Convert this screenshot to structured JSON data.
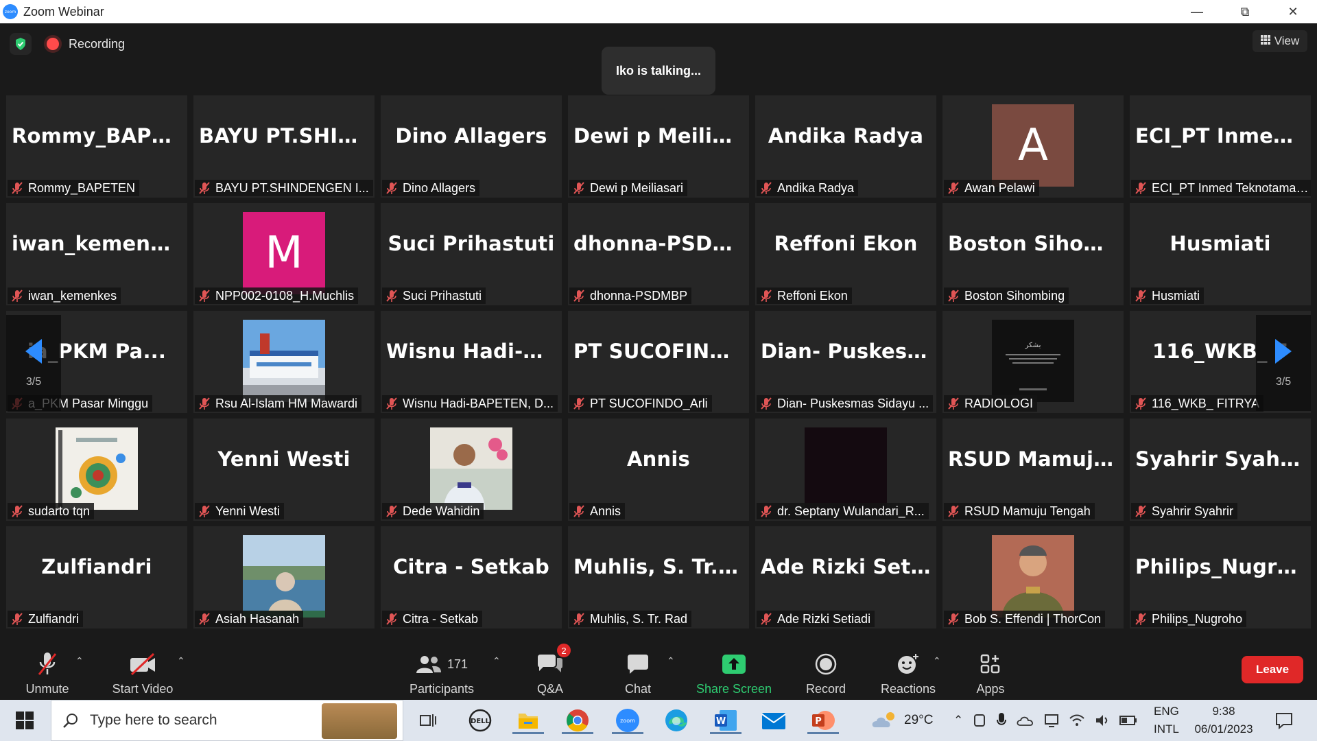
{
  "window": {
    "title": "Zoom Webinar"
  },
  "topbar": {
    "recording": "Recording",
    "talking": "Iko is talking...",
    "view": "View"
  },
  "tiles": [
    {
      "big": "Rommy_BAPET...",
      "label": "Rommy_BAPETEN"
    },
    {
      "big": "BAYU  PT.SHIND...",
      "label": "BAYU PT.SHINDENGEN I..."
    },
    {
      "big": "Dino Allagers",
      "label": "Dino Allagers"
    },
    {
      "big": "Dewi p Meiliasari",
      "label": "Dewi p Meiliasari"
    },
    {
      "big": "Andika Radya",
      "label": "Andika Radya"
    },
    {
      "avatar": "A",
      "avatar_color": "#7a4a40",
      "label": "Awan Pelawi"
    },
    {
      "big": "ECI_PT  Inmed  T...",
      "label": "ECI_PT Inmed Teknotama ..."
    },
    {
      "big": "iwan_kemenkes",
      "label": "iwan_kemenkes"
    },
    {
      "avatar": "M",
      "avatar_color": "#d81b7a",
      "label": "NPP002-0108_H.Muchlis"
    },
    {
      "big": "Suci Prihastuti",
      "label": "Suci Prihastuti"
    },
    {
      "big": "dhonna-PSDMBP",
      "label": "dhonna-PSDMBP"
    },
    {
      "big": "Reffoni Ekon",
      "label": "Reffoni Ekon"
    },
    {
      "big": "Boston  Sihombi...",
      "label": "Boston Sihombing"
    },
    {
      "big": "Husmiati",
      "label": "Husmiati"
    },
    {
      "big": "ia_PKM  Pa...",
      "label": "a_PKM Pasar Minggu"
    },
    {
      "pic": "hospital",
      "label": "Rsu Al-Islam HM Mawardi"
    },
    {
      "big": "Wisnu  Hadi-BA...",
      "label": "Wisnu Hadi-BAPETEN, D..."
    },
    {
      "big": "PT  SUCOFINDO...",
      "label": "PT SUCOFINDO_Arli"
    },
    {
      "big": "Dian-  Puskesma...",
      "label": "Dian- Puskesmas Sidayu ..."
    },
    {
      "pic": "dark-doc",
      "label": "RADIOLOGI"
    },
    {
      "big": "116_WKB_  F",
      "label": "116_WKB_ FITRYA"
    },
    {
      "pic": "book",
      "label": "sudarto tqn"
    },
    {
      "big": "Yenni Westi",
      "label": "Yenni Westi"
    },
    {
      "pic": "person-flowers",
      "label": "Dede Wahidin"
    },
    {
      "big": "Annis",
      "label": "Annis"
    },
    {
      "pic": "black",
      "label": "dr. Septany Wulandari_R..."
    },
    {
      "big": "RSUD  Mamuju...",
      "label": "RSUD Mamuju Tengah"
    },
    {
      "big": "Syahrir Syahrir",
      "label": "Syahrir Syahrir"
    },
    {
      "big": "Zulfiandri",
      "label": "Zulfiandri"
    },
    {
      "pic": "sea-person",
      "label": "Asiah Hasanah"
    },
    {
      "big": "Citra - Setkab",
      "label": "Citra - Setkab"
    },
    {
      "big": "Muhlis, S. Tr. Rad",
      "label": "Muhlis, S. Tr. Rad"
    },
    {
      "big": "Ade Rizki Setiadi",
      "label": "Ade Rizki Setiadi"
    },
    {
      "pic": "uniform",
      "label": "Bob S. Effendi | ThorCon"
    },
    {
      "big": "Philips_Nugroho",
      "label": "Philips_Nugroho"
    }
  ],
  "pager": {
    "left": "3/5",
    "right": "3/5"
  },
  "toolbar": {
    "unmute": "Unmute",
    "start_video": "Start Video",
    "participants": "Participants",
    "participants_count": "171",
    "qa": "Q&A",
    "qa_badge": "2",
    "chat": "Chat",
    "share": "Share Screen",
    "record": "Record",
    "reactions": "Reactions",
    "apps": "Apps",
    "leave": "Leave"
  },
  "taskbar": {
    "search_placeholder": "Type here to search",
    "weather": "29°C",
    "lang1": "ENG",
    "lang2": "INTL",
    "time": "9:38",
    "date": "06/01/2023"
  },
  "colors": {
    "accent_green": "#2ecc71",
    "leave_red": "#e02828",
    "zoom_blue": "#2D8CFF"
  }
}
